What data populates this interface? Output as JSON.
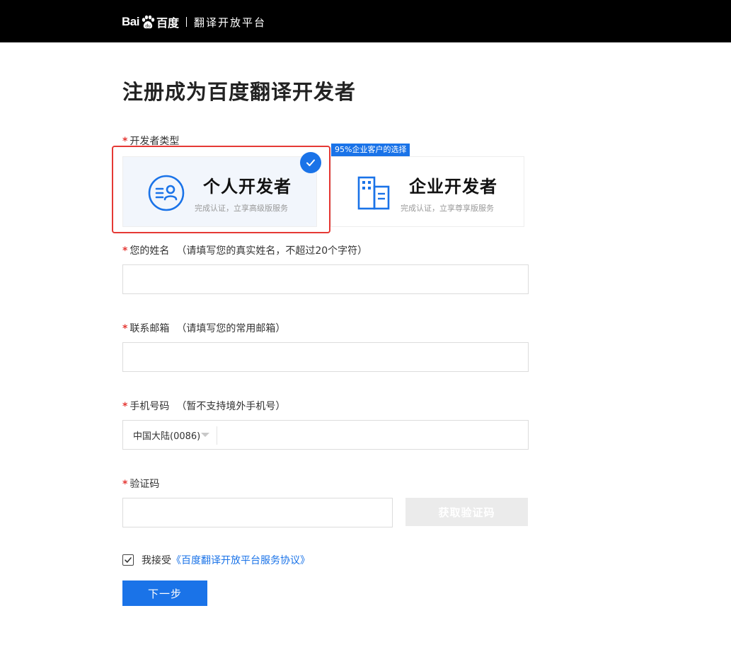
{
  "header": {
    "logo_bai": "Bai",
    "logo_cn": "百度",
    "subtitle": "翻译开放平台"
  },
  "page_title": "注册成为百度翻译开发者",
  "developer_type": {
    "label": "开发者类型",
    "tag": "95%企业客户的选择",
    "options": [
      {
        "title": "个人开发者",
        "subtitle": "完成认证，立享高级版服务",
        "selected": true
      },
      {
        "title": "企业开发者",
        "subtitle": "完成认证，立享尊享版服务",
        "selected": false
      }
    ]
  },
  "fields": {
    "name": {
      "label": "您的姓名",
      "hint": "（请填写您的真实姓名，不超过20个字符）",
      "value": ""
    },
    "email": {
      "label": "联系邮箱",
      "hint": "（请填写您的常用邮箱）",
      "value": ""
    },
    "phone": {
      "label": "手机号码",
      "hint": "（暂不支持境外手机号）",
      "region": "中国大陆(0086)",
      "value": ""
    },
    "code": {
      "label": "验证码",
      "value": "",
      "button": "获取验证码"
    }
  },
  "agreement": {
    "checked": true,
    "text": "我接受",
    "link": "《百度翻译开放平台服务协议》"
  },
  "next_button": "下一步",
  "colors": {
    "accent": "#1a73e8",
    "required": "#e53935",
    "highlight": "#e53935",
    "header_bg": "#000000"
  },
  "icons": [
    "baidu-paw-icon",
    "person-card-icon",
    "building-icon",
    "check-icon",
    "caret-down-icon",
    "checkbox-check-icon"
  ]
}
